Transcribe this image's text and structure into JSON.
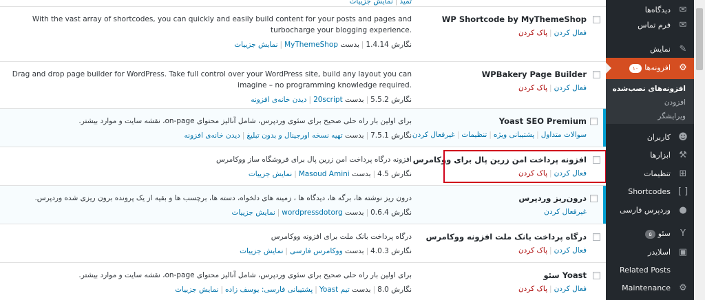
{
  "top_partial": {
    "actions": [
      "ثمید",
      "نمایش جزییات"
    ]
  },
  "plugins": [
    {
      "name": "WP Shortcode by MyThemeShop",
      "active": false,
      "actions": [
        "فعال کردن",
        "پاک کردن"
      ],
      "description": "With the vast array of shortcodes, you can quickly and easily build content for your posts and pages and turbocharge your blogging experience.",
      "version_label": "نگارش 1.4.14",
      "by_label": "بدست",
      "author": "MyThemeShop",
      "links": [
        "نمایش جزییات"
      ]
    },
    {
      "name": "WPBakery Page Builder",
      "active": false,
      "actions": [
        "فعال کردن",
        "پاک کردن"
      ],
      "description": "Drag and drop page builder for WordPress. Take full control over your WordPress site, build any layout you can imagine – no programming knowledge required.",
      "version_label": "نگارش 5.5.2",
      "by_label": "بدست",
      "author": "20script",
      "links": [
        "دیدن خانه‌ی افزونه"
      ]
    },
    {
      "name": "Yoast SEO Premium",
      "active": true,
      "actions": [
        "سوالات متداول",
        "پشتیبانی ویژه",
        "تنظیمات",
        "غیرفعال کردن"
      ],
      "description": "برای اولین بار راه حلی صحیح برای سئوی وردپرس، شامل آنالیز محتوای on-page، نقشه سایت و موارد بیشتر.",
      "version_label": "نگارش 7.5.1",
      "by_label": "بدست",
      "author": "تهیه نسخه اورجینال و بدون تبلیغ",
      "links": [
        "دیدن خانه‌ی افزونه"
      ]
    },
    {
      "name": "افزونه پرداخت امن زرین پال برای ووکامرس",
      "active": false,
      "actions": [
        "فعال کردن",
        "پاک کردن"
      ],
      "description": "افزونه درگاه پرداخت امن زرین پال برای فروشگاه ساز ووکامرس",
      "version_label": "نگارش 4.5",
      "by_label": "بدست",
      "author": "Masoud Amini",
      "links": [
        "نمایش جزییات"
      ]
    },
    {
      "name": "درون‌ریز وردپرس",
      "active": true,
      "actions": [
        "غیرفعال کردن"
      ],
      "description": "درون ریز نوشته ها، برگه ها، دیدگاه ها ، زمینه های دلخواه، دسته ها، برچسب ها و بقیه از یک پرونده برون ریزی شده وردپرس.",
      "version_label": "نگارش 0.6.4",
      "by_label": "بدست",
      "author": "wordpressdotorg",
      "links": [
        "نمایش جزییات"
      ]
    },
    {
      "name": "درگاه پرداخت بانک ملت افزونه ووکامرس",
      "active": false,
      "actions": [
        "فعال کردن",
        "پاک کردن"
      ],
      "description": "درگاه پرداخت بانک ملت برای افزونه ووکامرس",
      "version_label": "نگارش 4.0.3",
      "by_label": "بدست",
      "author": "ووکامرس فارسی",
      "links": [
        "نمایش جزییات"
      ]
    },
    {
      "name": "Yoast سئو",
      "active": false,
      "actions": [
        "فعال کردن",
        "پاک کردن"
      ],
      "description": "برای اولین بار راه حلی صحیح برای سئوی وردپرس، شامل آنالیز محتوای on-page، نقشه سایت و موارد بیشتر.",
      "version_label": "نگارش 8.0",
      "by_label": "بدست",
      "author": "تیم Yoast",
      "links": [
        "پشتیبانی فارسی: یوسف زاده",
        "نمایش جزییات"
      ]
    }
  ],
  "sidebar": {
    "items": [
      {
        "label": "دیدگاه‌ها",
        "icon": "comment-icon"
      },
      {
        "label": "فرم تماس",
        "icon": "mail-icon"
      },
      {
        "label": "نمایش",
        "icon": "brush-icon"
      },
      {
        "label": "افزونه‌ها",
        "icon": "plugin-icon",
        "badge": "۱۰",
        "current": true
      },
      {
        "label": "کاربران",
        "icon": "users-icon"
      },
      {
        "label": "ابزارها",
        "icon": "wrench-icon"
      },
      {
        "label": "تنظیمات",
        "icon": "settings-icon"
      },
      {
        "label": "Shortcodes",
        "icon": "brackets-icon"
      },
      {
        "label": "وردپرس فارسی",
        "icon": "wp-persian-icon"
      },
      {
        "label": "سئو",
        "icon": "yoast-icon",
        "badge": "۵"
      },
      {
        "label": "اسلایدر",
        "icon": "slider-icon"
      },
      {
        "label": "Related Posts",
        "icon": "related-icon"
      },
      {
        "label": "Maintenance",
        "icon": "maintenance-icon"
      }
    ],
    "submenu": [
      "افزونه‌های نصب‌شده",
      "افزودن",
      "ویرایشگر"
    ]
  },
  "colors": {
    "accent": "#d54e21",
    "link": "#0073aa",
    "delete": "#aa0000",
    "active_border": "#00a0d2",
    "highlight_box": "#d0021b"
  }
}
